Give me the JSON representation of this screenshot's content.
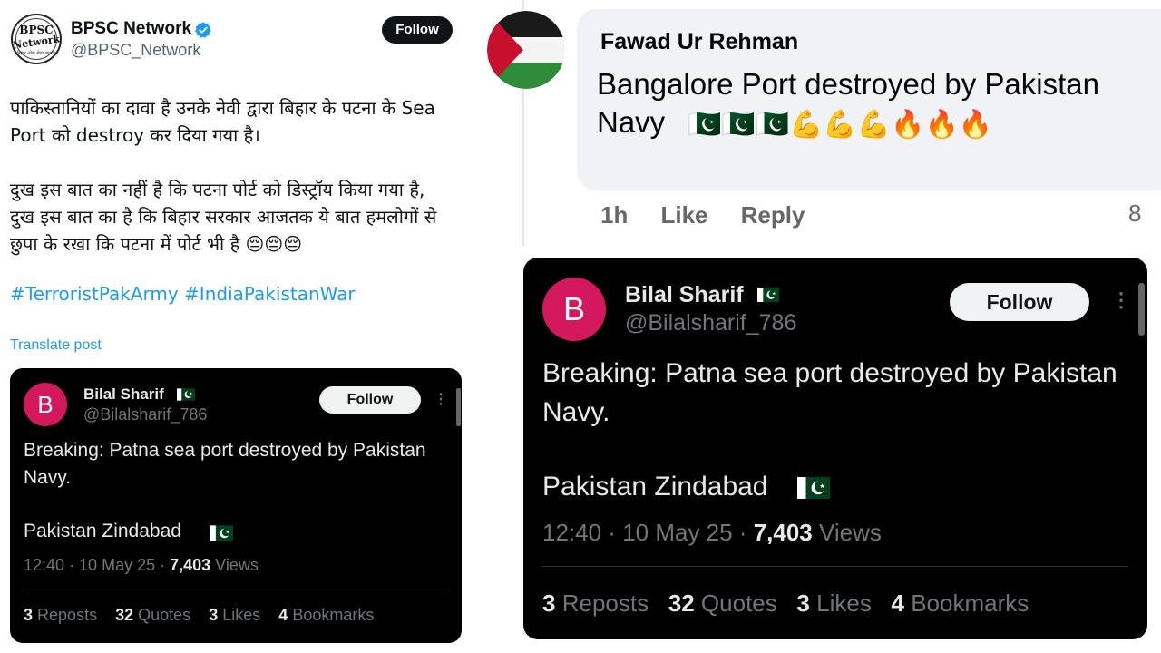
{
  "main_tweet": {
    "avatar_text": [
      "BPSC",
      "Network",
      "बिहार लोक सेवा आयोग"
    ],
    "author_name": "BPSC Network",
    "author_handle": "@BPSC_Network",
    "verified": true,
    "follow_label": "Follow",
    "body_lines": [
      "पाकिस्तानियों का दावा है उनके नेवी द्वारा बिहार के पटना के Sea",
      "Port को destroy कर दिया गया है।",
      "दुख इस बात का नहीं है कि पटना पोर्ट को डिस्ट्रॉय किया गया है,",
      "दुख इस बात का है कि बिहार सरकार आजतक ये बात हमलोगों से",
      "छुपा के रखा कि पटना में पोर्ट भी है 😔😔😔"
    ],
    "hashtags": "#TerroristPakArmy #IndiaPakistanWar",
    "translate_label": "Translate post",
    "accent_color": "#1d9bf0"
  },
  "quoted_tweet": {
    "avatar_letter": "B",
    "author_name": "Bilal Sharif",
    "author_handle": "@Bilalsharif_786",
    "follow_label": "Follow",
    "more_label": "⋮",
    "body": "Breaking: Patna sea port destroyed by Pakistan Navy.",
    "closing": "Pakistan Zindabad",
    "time": "12:40",
    "date": "10 May 25",
    "views_count": "7,403",
    "views_label": "Views",
    "stats": {
      "reposts_count": "3",
      "reposts_label": "Reposts",
      "quotes_count": "32",
      "quotes_label": "Quotes",
      "likes_count": "3",
      "likes_label": "Likes",
      "bookmarks_count": "4",
      "bookmarks_label": "Bookmarks"
    },
    "avatar_color": "#d4185e",
    "flag_color": "#01411c"
  },
  "fb_comment": {
    "author_name": "Fawad Ur Rehman",
    "text_line1": "Bangalore Port destroyed by Pakistan",
    "text_line2": "Navy",
    "emoji": "🇵🇰🇵🇰🇵🇰💪💪💪🔥🔥🔥",
    "time_label": "1h",
    "like_label": "Like",
    "reply_label": "Reply",
    "reaction_count": "8"
  }
}
